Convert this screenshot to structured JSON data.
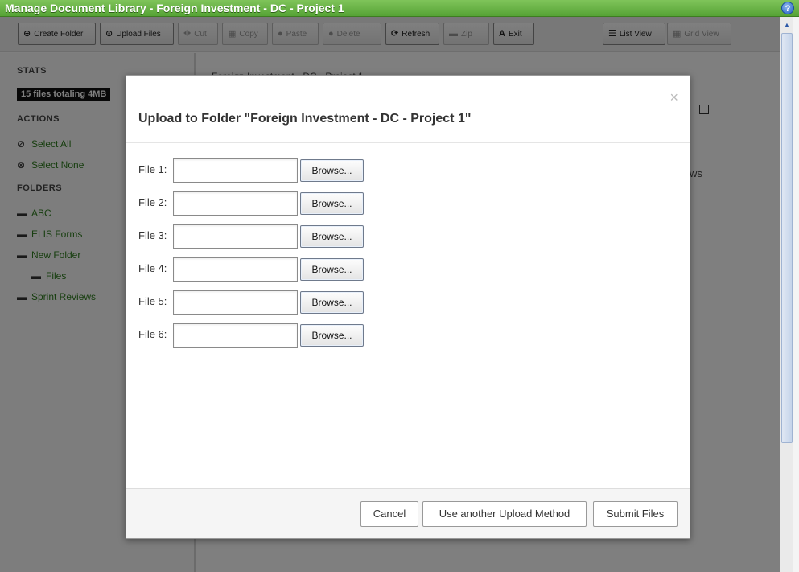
{
  "window": {
    "title": "Manage Document Library - Foreign Investment - DC - Project 1",
    "help_icon": "?"
  },
  "toolbar": {
    "buttons": [
      {
        "label": "Create Folder",
        "icon": "⊕",
        "enabled": true
      },
      {
        "label": "Upload Files",
        "icon": "⊙",
        "enabled": true
      },
      {
        "label": "Cut",
        "icon": "✥",
        "enabled": false
      },
      {
        "label": "Copy",
        "icon": "▦",
        "enabled": false
      },
      {
        "label": "Paste",
        "icon": "●",
        "enabled": false
      },
      {
        "label": "Delete",
        "icon": "●",
        "enabled": false
      },
      {
        "label": "Refresh",
        "icon": "⟳",
        "enabled": true
      },
      {
        "label": "Zip",
        "icon": "▬",
        "enabled": false
      },
      {
        "label": "Exit",
        "icon": "A",
        "enabled": true
      },
      {
        "label": "List View",
        "icon": "☰",
        "enabled": true
      },
      {
        "label": "Grid View",
        "icon": "▦",
        "enabled": false
      }
    ]
  },
  "sidebar": {
    "stats_heading": "STATS",
    "stats_badge": "15 files totaling 4MB",
    "actions_heading": "ACTIONS",
    "actions": [
      "Select All",
      "Select None"
    ],
    "folders_heading": "FOLDERS",
    "folders": [
      "ABC",
      "ELIS Forms",
      "New Folder",
      "Files",
      "Sprint Reviews"
    ]
  },
  "main": {
    "breadcrumb": "Foreign Investment - DC - Project 1",
    "views_text": "ws"
  },
  "modal": {
    "title": "Upload to Folder \"Foreign Investment - DC - Project 1\"",
    "close": "×",
    "files": [
      {
        "label": "File 1:",
        "value": "",
        "browse": "Browse..."
      },
      {
        "label": "File 2:",
        "value": "",
        "browse": "Browse..."
      },
      {
        "label": "File 3:",
        "value": "",
        "browse": "Browse..."
      },
      {
        "label": "File 4:",
        "value": "",
        "browse": "Browse..."
      },
      {
        "label": "File 5:",
        "value": "",
        "browse": "Browse..."
      },
      {
        "label": "File 6:",
        "value": "",
        "browse": "Browse..."
      }
    ],
    "footer": {
      "cancel": "Cancel",
      "alt_method": "Use another Upload Method",
      "submit": "Submit Files"
    }
  },
  "colors": {
    "titlebar": "#56a336",
    "link": "#2e7d1f",
    "overlay": "rgba(0,0,0,0.5)"
  }
}
